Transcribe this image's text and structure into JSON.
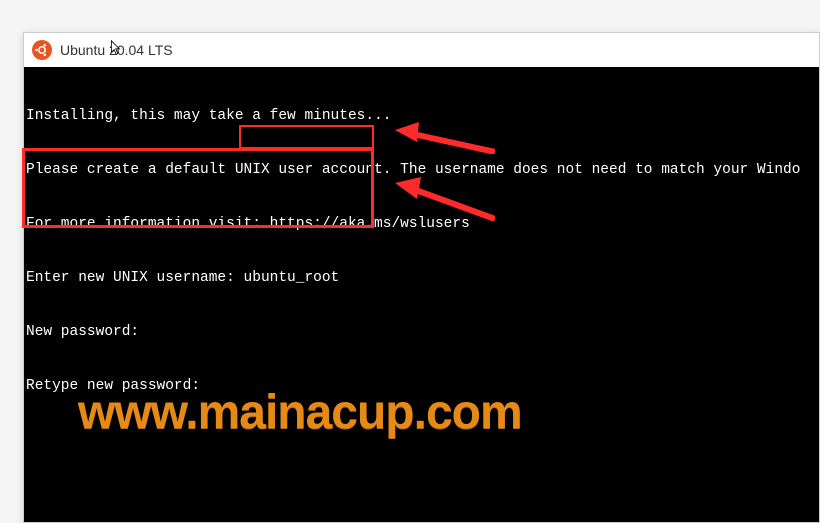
{
  "window": {
    "title": "Ubuntu 20.04 LTS"
  },
  "terminal": {
    "lines": [
      "Installing, this may take a few minutes...",
      "Please create a default UNIX user account. The username does not need to match your Windo",
      "For more information visit: https://aka.ms/wslusers",
      "Enter new UNIX username: ubuntu_root",
      "New password:",
      "Retype new password:"
    ],
    "username_input": "ubuntu_root"
  },
  "watermark": {
    "text": "www.mainacup.com"
  },
  "annotations": {
    "color": "#ff2a2a"
  }
}
